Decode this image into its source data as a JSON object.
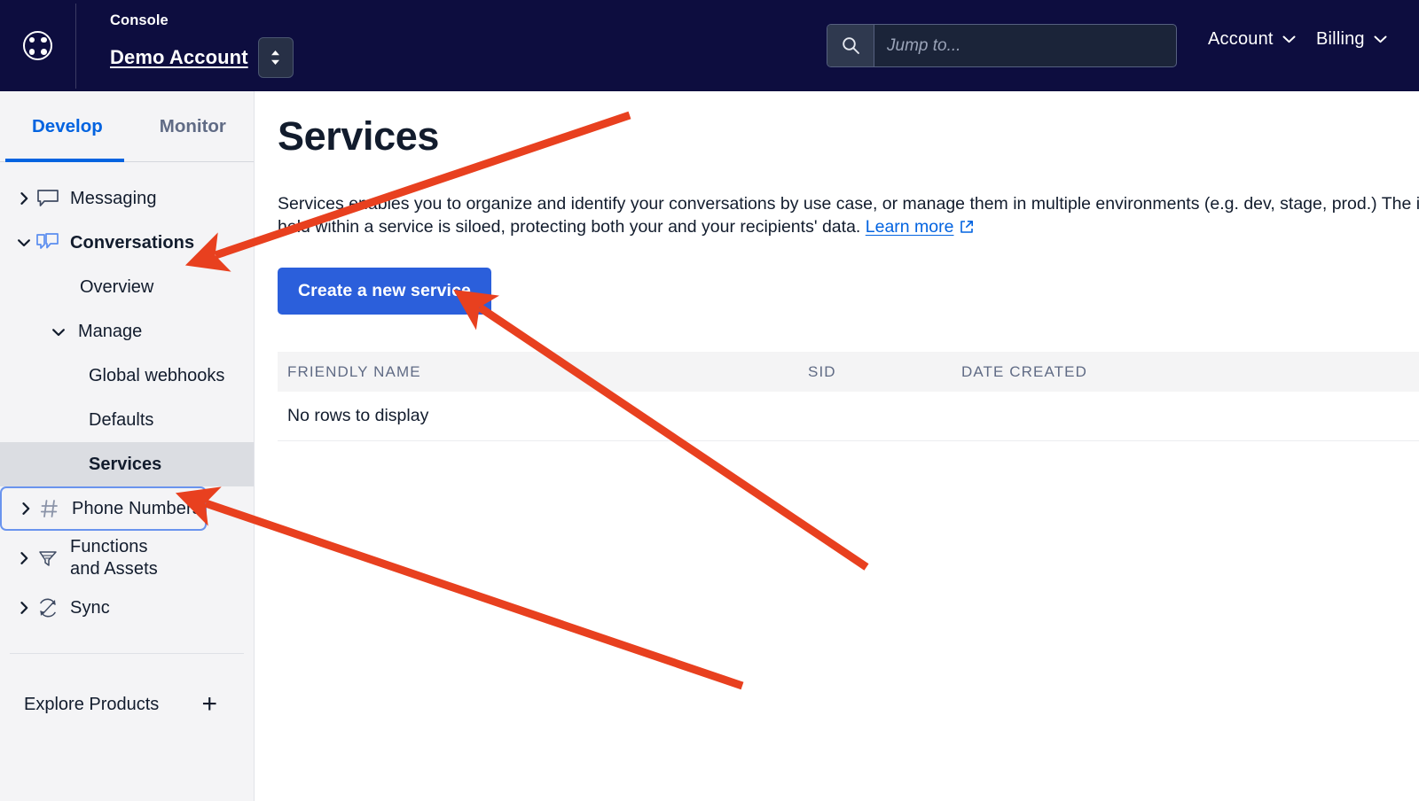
{
  "header": {
    "logo_icon": "console-grid-logo-icon",
    "console_label": "Console",
    "account_name": "Demo Account",
    "account_switcher_icon": "up-down-chevron-icon",
    "search": {
      "icon": "search-icon",
      "placeholder": "Jump to...",
      "value": ""
    },
    "menus": [
      {
        "label": "Account",
        "icon": "chevron-down-icon"
      },
      {
        "label": "Billing",
        "icon": "chevron-down-icon"
      }
    ]
  },
  "sidebar": {
    "tabs": [
      {
        "label": "Develop",
        "active": true
      },
      {
        "label": "Monitor",
        "active": false
      }
    ],
    "items": [
      {
        "label": "Messaging",
        "icon": "speech-bubble-icon",
        "caret": "chevron-right-icon",
        "expanded": false,
        "bold": false
      },
      {
        "label": "Conversations",
        "icon": "conversations-bubbles-icon",
        "caret": "chevron-down-icon",
        "expanded": true,
        "bold": true
      },
      {
        "label": "Overview",
        "level": 2
      },
      {
        "label": "Manage",
        "level": 2,
        "caret": "chevron-down-icon",
        "expanded": true
      },
      {
        "label": "Global webhooks",
        "level": 3
      },
      {
        "label": "Defaults",
        "level": 3
      },
      {
        "label": "Services",
        "level": 3,
        "active": true
      },
      {
        "label": "Phone Numbers",
        "icon": "hash-icon",
        "caret": "chevron-right-icon",
        "focused": true
      },
      {
        "label": "Functions and Assets",
        "icon": "funnel-icon",
        "caret": "chevron-right-icon"
      },
      {
        "label": "Sync",
        "icon": "sync-refresh-icon",
        "caret": "chevron-right-icon"
      }
    ],
    "explore": {
      "label": "Explore Products",
      "icon": "plus-icon"
    }
  },
  "main": {
    "title": "Services",
    "description_part1": "Services enables you to organize and identify your conversations by use case, or manage them in multiple environments (e.g. dev, stage, prod.) The information held within a service is siloed, protecting both your and your recipients' data. ",
    "learn_more_label": "Learn more",
    "learn_more_icon": "external-link-icon",
    "create_button_label": "Create a new service",
    "table": {
      "columns": [
        "FRIENDLY NAME",
        "SID",
        "DATE CREATED"
      ],
      "empty_message": "No rows to display",
      "rows": []
    }
  },
  "annotations": {
    "arrow_color": "#e8401f",
    "arrows": [
      {
        "name": "arrow-to-conversations",
        "target": "Conversations"
      },
      {
        "name": "arrow-to-create-service-button",
        "target": "Create a new service"
      },
      {
        "name": "arrow-to-services-sidebar-item",
        "target": "Services"
      }
    ]
  },
  "colors": {
    "header_bg": "#0d0d3f",
    "accent_blue": "#0263e0",
    "button_blue": "#2b5fdb",
    "sidebar_bg": "#f4f4f6",
    "active_row": "#dbdde2",
    "annotation_red": "#e8401f"
  }
}
